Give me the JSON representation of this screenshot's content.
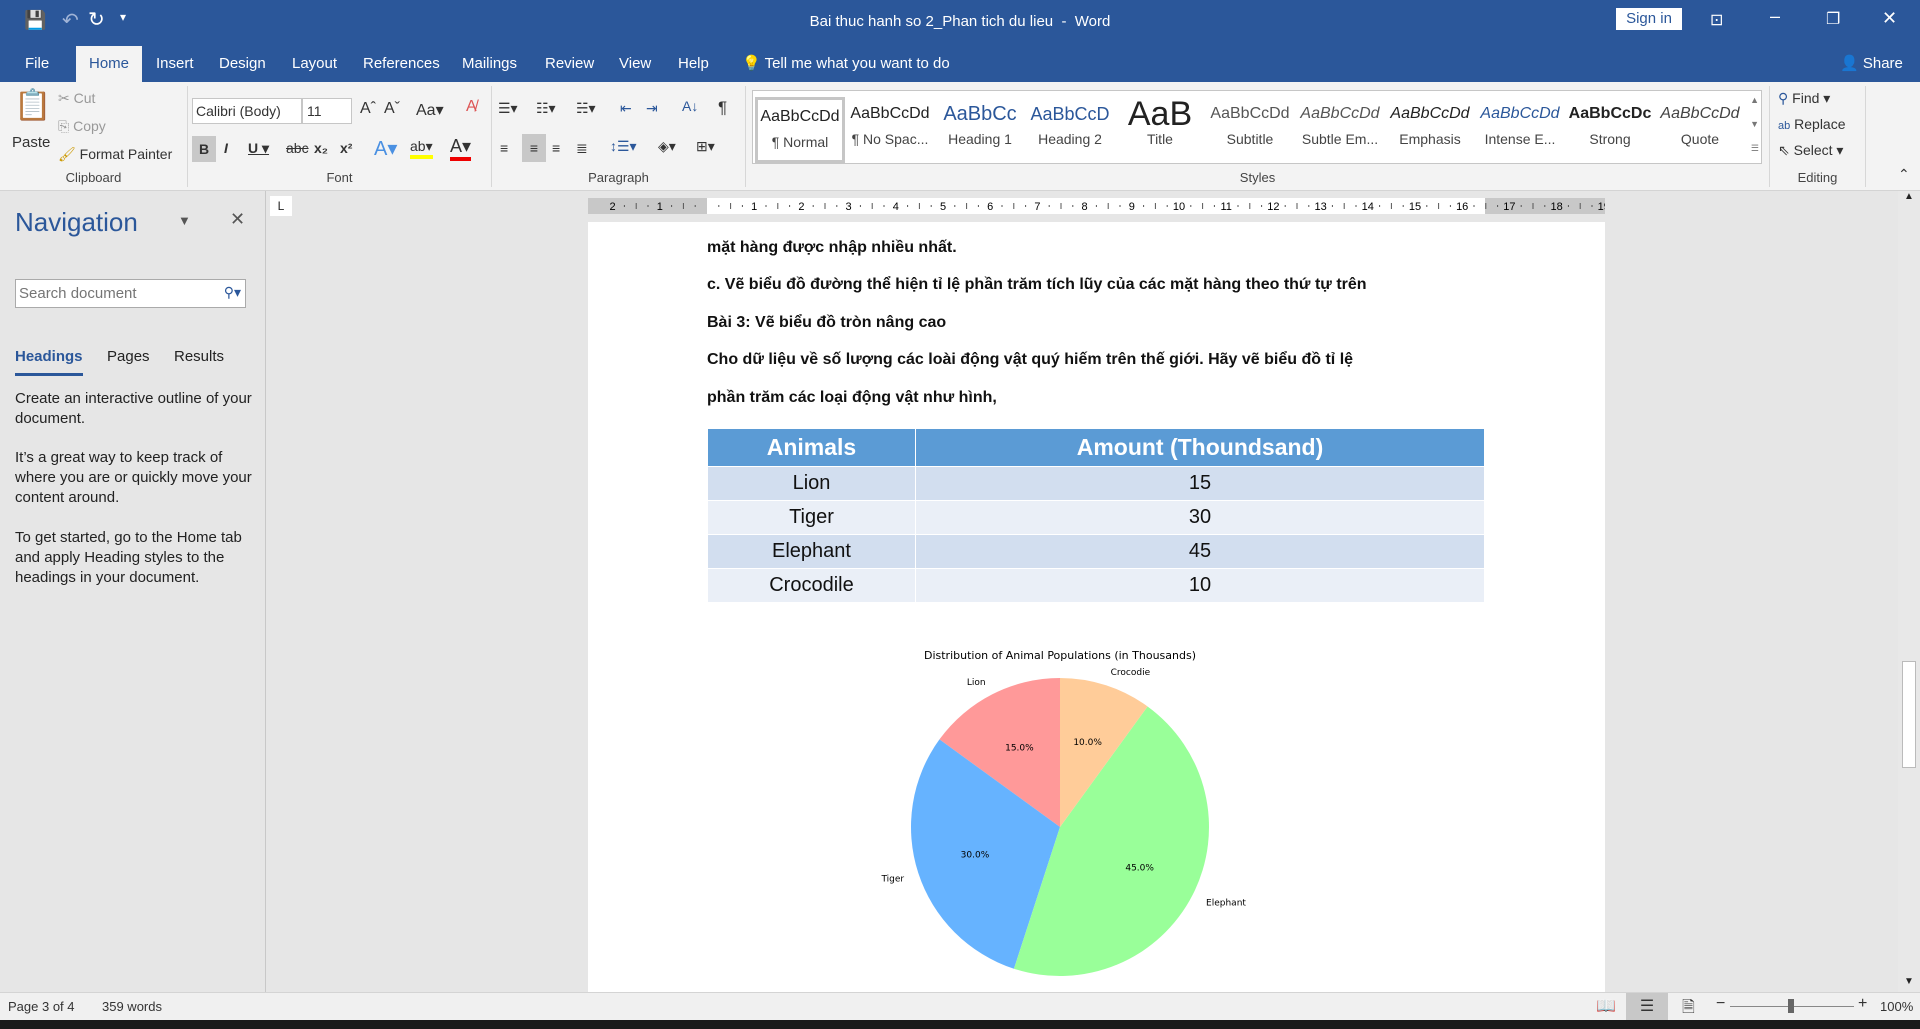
{
  "window": {
    "title": "Bai thuc hanh so 2_Phan tich du lieu  -  Word",
    "sign_in": "Sign in",
    "share": "Share"
  },
  "tabs": [
    {
      "label": "File"
    },
    {
      "label": "Home",
      "active": true
    },
    {
      "label": "Insert"
    },
    {
      "label": "Design"
    },
    {
      "label": "Layout"
    },
    {
      "label": "References"
    },
    {
      "label": "Mailings"
    },
    {
      "label": "Review"
    },
    {
      "label": "View"
    },
    {
      "label": "Help"
    }
  ],
  "tell_me": "Tell me what you want to do",
  "ribbon": {
    "clipboard": {
      "label": "Clipboard",
      "paste": "Paste",
      "cut": "Cut",
      "copy": "Copy",
      "format_painter": "Format Painter"
    },
    "font": {
      "label": "Font",
      "family": "Calibri (Body)",
      "size": "11"
    },
    "paragraph": {
      "label": "Paragraph"
    },
    "styles": {
      "label": "Styles",
      "items": [
        {
          "preview": "AaBbCcDd",
          "name": "¶ Normal"
        },
        {
          "preview": "AaBbCcDd",
          "name": "¶ No Spac..."
        },
        {
          "preview": "AaBbCc",
          "name": "Heading 1"
        },
        {
          "preview": "AaBbCcD",
          "name": "Heading 2"
        },
        {
          "preview": "AaB",
          "name": "Title"
        },
        {
          "preview": "AaBbCcDd",
          "name": "Subtitle"
        },
        {
          "preview": "AaBbCcDd",
          "name": "Subtle Em..."
        },
        {
          "preview": "AaBbCcDd",
          "name": "Emphasis"
        },
        {
          "preview": "AaBbCcDd",
          "name": "Intense E..."
        },
        {
          "preview": "AaBbCcDc",
          "name": "Strong"
        },
        {
          "preview": "AaBbCcDd",
          "name": "Quote"
        }
      ]
    },
    "editing": {
      "label": "Editing",
      "find": "Find",
      "replace": "Replace",
      "select": "Select"
    }
  },
  "navigation": {
    "title": "Navigation",
    "search_placeholder": "Search document",
    "tabs": [
      "Headings",
      "Pages",
      "Results"
    ],
    "p1": "Create an interactive outline of your document.",
    "p2": "It’s a great way to keep track of where you are or quickly move your content around.",
    "p3": "To get started, go to the Home tab and apply Heading styles to the headings in your document."
  },
  "document": {
    "lines": [
      "mặt hàng được nhập nhiều nhất.",
      "c. Vẽ biểu đồ đường thể hiện tỉ lệ phần trăm tích lũy của các mặt hàng theo thứ tự trên",
      "Bài 3: Vẽ biểu đồ tròn nâng cao",
      "Cho dữ liệu về số lượng các loài động vật quý hiếm trên thế giới. Hãy vẽ biểu đồ tỉ lệ",
      "phần trăm các loại động vật như hình,"
    ],
    "table": {
      "headers": [
        "Animals",
        "Amount (Thoundsand)"
      ],
      "rows": [
        [
          "Lion",
          "15"
        ],
        [
          "Tiger",
          "30"
        ],
        [
          "Elephant",
          "45"
        ],
        [
          "Crocodile",
          "10"
        ]
      ]
    }
  },
  "chart_data": {
    "type": "pie",
    "title": "Distribution of Animal Populations (in Thousands)",
    "labels": [
      "Lion",
      "Tiger",
      "Elephant",
      "Crocodie"
    ],
    "values": [
      15,
      30,
      45,
      10
    ],
    "pct_labels": [
      "15.0%",
      "30.0%",
      "45.0%",
      "10.0%"
    ],
    "colors": [
      "#ff9999",
      "#66b3ff",
      "#99ff99",
      "#ffcc99"
    ],
    "start_angle": 90,
    "direction": "counterclockwise"
  },
  "status": {
    "page": "Page 3 of 4",
    "words": "359 words",
    "zoom": "100%"
  },
  "colors": {
    "brand": "#2b579a"
  }
}
